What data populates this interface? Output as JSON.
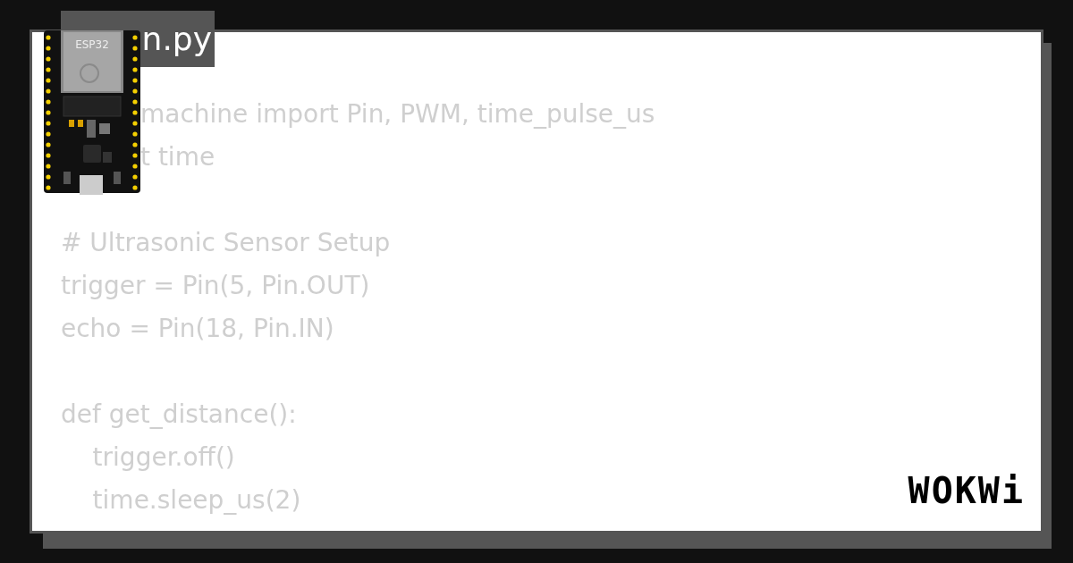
{
  "title": "n.py",
  "board": {
    "label": "ESP32"
  },
  "code_lines": [
    {
      "kind": "obscured",
      "text": "machine import Pin, PWM, time_pulse_us"
    },
    {
      "kind": "obscured",
      "text": "t time"
    },
    {
      "kind": "blank"
    },
    {
      "kind": "code",
      "text": "# Ultrasonic Sensor Setup"
    },
    {
      "kind": "code",
      "text": "trigger = Pin(5, Pin.OUT)"
    },
    {
      "kind": "code",
      "text": "echo = Pin(18, Pin.IN)"
    },
    {
      "kind": "blank"
    },
    {
      "kind": "code",
      "text": "def get_distance():"
    },
    {
      "kind": "code",
      "text": "    trigger.off()"
    },
    {
      "kind": "code",
      "text": "    time.sleep_us(2)"
    }
  ],
  "logo": "WOKWi"
}
